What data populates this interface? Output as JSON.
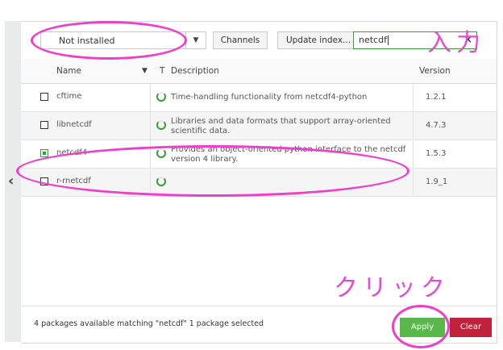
{
  "toolbar": {
    "filter_value": "Not installed",
    "channels_label": "Channels",
    "update_index_label": "Update index...",
    "search_value": "netcdf",
    "clear_search_icon": "×"
  },
  "table": {
    "headers": {
      "name": "Name",
      "sort_icon": "chevron-down-icon",
      "t": "T",
      "description": "Description",
      "version": "Version"
    },
    "rows": [
      {
        "name": "cftime",
        "description": "Time-handling functionality from netcdf4-python",
        "version": "1.2.1",
        "selected": false
      },
      {
        "name": "libnetcdf",
        "description": "Libraries and data formats that support array-oriented scientific data.",
        "version": "4.7.3",
        "selected": false
      },
      {
        "name": "netcdf4",
        "description": "Provides an object-oriented python interface to the netcdf version 4 library.",
        "version": "1.5.3",
        "selected": true
      },
      {
        "name": "r-rnetcdf",
        "description": "",
        "version": "1.9_1",
        "selected": false
      }
    ]
  },
  "footer": {
    "status": "4 packages available matching \"netcdf\"   1 package selected",
    "apply_label": "Apply",
    "clear_label": "Clear"
  },
  "annotations": {
    "input_note": "入力",
    "click_note": "クリック",
    "color": "#ee3fc8"
  },
  "colors": {
    "apply": "#58b94a",
    "clear": "#c1213a",
    "status_ring": "#3a9b3a"
  }
}
